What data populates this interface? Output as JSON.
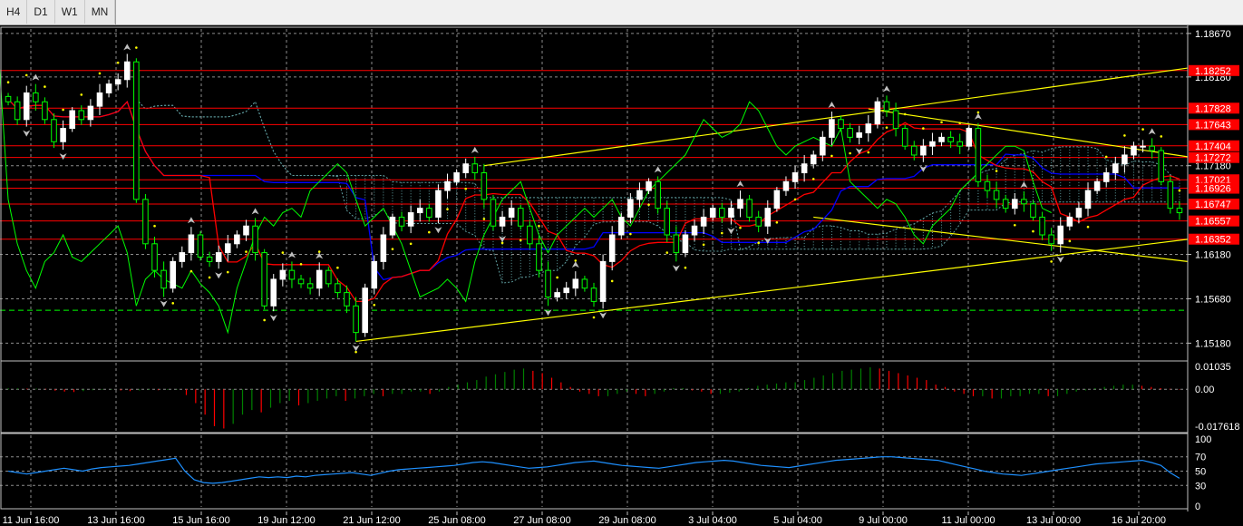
{
  "timeframes": [
    "H4",
    "D1",
    "W1",
    "MN"
  ],
  "colors": {
    "background": "#000000",
    "grid": "#8c8c8c",
    "bull_candle": "#ffffff",
    "bear_candle": "#00ff00",
    "hline": "#ff0000",
    "trendline": "#ffff00",
    "kijun": "#0000ff",
    "tenkan": "#ff0000",
    "chikou": "#00ff00",
    "cloud": "#5f9ea0",
    "sar": "#ffff00",
    "osc_up": "#008000",
    "osc_down": "#ff0000",
    "rsi": "#1e90ff"
  },
  "chart_data": [
    {
      "type": "candlestick",
      "panel": "main",
      "symbol_timeframe": "H4",
      "y_ticks": [
        "1.18670",
        "1.18180",
        "1.17180",
        "1.16180",
        "1.15680",
        "1.15180"
      ],
      "ylim": [
        1.15,
        1.1872
      ],
      "x_ticks": [
        "11 Jun 16:00",
        "13 Jun 16:00",
        "15 Jun 16:00",
        "19 Jun 12:00",
        "21 Jun 12:00",
        "25 Jun 08:00",
        "27 Jun 08:00",
        "29 Jun 08:00",
        "3 Jul 04:00",
        "5 Jul 04:00",
        "9 Jul 00:00",
        "11 Jul 00:00",
        "13 Jul 00:00",
        "16 Jul 20:00"
      ],
      "horizontal_levels": [
        {
          "label": "1.18252",
          "value": 1.18252
        },
        {
          "label": "1.17828",
          "value": 1.17828
        },
        {
          "label": "1.17643",
          "value": 1.17643
        },
        {
          "label": "1.17404",
          "value": 1.17404
        },
        {
          "label": "1.17272",
          "value": 1.17272
        },
        {
          "label": "1.17021",
          "value": 1.17021
        },
        {
          "label": "1.16926",
          "value": 1.16926
        },
        {
          "label": "1.16747",
          "value": 1.16747
        },
        {
          "label": "1.16557",
          "value": 1.16557
        },
        {
          "label": "1.16352",
          "value": 1.16352
        }
      ],
      "green_dashed_level": 1.1555,
      "series": [
        {
          "values": [
            1.179,
            1.177,
            1.18,
            1.179,
            1.177,
            1.1745,
            1.176,
            1.178,
            1.177,
            1.1785,
            1.18,
            1.181,
            1.1815,
            1.1835,
            1.168,
            1.163,
            1.16,
            1.158,
            1.161,
            1.162,
            1.164,
            1.1615,
            1.161,
            1.162,
            1.163,
            1.164,
            1.165,
            1.162,
            1.156,
            1.159,
            1.16,
            1.159,
            1.1585,
            1.158,
            1.16,
            1.1585,
            1.1575,
            1.156,
            1.153,
            1.158,
            1.161,
            1.164,
            1.166,
            1.165,
            1.1665,
            1.167,
            1.166,
            1.169,
            1.17,
            1.171,
            1.172,
            1.171,
            1.168,
            1.165,
            1.166,
            1.167,
            1.165,
            1.163,
            1.16,
            1.157,
            1.1575,
            1.158,
            1.159,
            1.158,
            1.1565,
            1.161,
            1.164,
            1.166,
            1.168,
            1.169,
            1.17,
            1.167,
            1.164,
            1.162,
            1.164,
            1.165,
            1.166,
            1.167,
            1.166,
            1.167,
            1.168,
            1.166,
            1.165,
            1.167,
            1.169,
            1.17,
            1.171,
            1.172,
            1.173,
            1.175,
            1.177,
            1.176,
            1.175,
            1.1755,
            1.1765,
            1.179,
            1.178,
            1.176,
            1.174,
            1.173,
            1.174,
            1.1745,
            1.175,
            1.1745,
            1.174,
            1.176,
            1.17,
            1.169,
            1.168,
            1.167,
            1.168,
            1.1675,
            1.166,
            1.164,
            1.163,
            1.165,
            1.166,
            1.167,
            1.169,
            1.17,
            1.171,
            1.172,
            1.173,
            1.174,
            1.174,
            1.1735,
            1.17,
            1.167,
            1.1665
          ]
        }
      ]
    },
    {
      "type": "bar",
      "panel": "oscillator",
      "y_ticks": [
        "0.01035",
        "0.00",
        "-0.017618"
      ],
      "ylim": [
        -0.018,
        0.0115
      ],
      "series": [
        {
          "values": [
            0.0004,
            0.0004,
            0.0003,
            0.0003,
            0.0002,
            -0.0006,
            -0.001,
            -0.0012,
            -0.0008,
            -0.0004,
            -0.0003,
            -0.0002,
            -0.0005,
            -0.0008,
            -0.0005,
            -0.0003,
            -0.0004,
            -0.0003,
            -0.0002,
            -0.0025,
            -0.006,
            -0.011,
            -0.016,
            -0.017,
            -0.015,
            -0.011,
            -0.009,
            -0.01,
            -0.008,
            -0.006,
            -0.005,
            -0.007,
            -0.006,
            -0.005,
            -0.004,
            -0.003,
            -0.005,
            -0.004,
            -0.003,
            -0.002,
            -0.003,
            -0.002,
            -0.002,
            -0.001,
            -0.001,
            -0.002,
            -0.001,
            0.001,
            0.002,
            0.003,
            0.004,
            0.0055,
            0.0065,
            0.0075,
            0.0085,
            0.009,
            0.008,
            0.007,
            0.005,
            0.003,
            0.001,
            -0.001,
            -0.002,
            -0.003,
            -0.003,
            -0.002,
            -0.001,
            -0.002,
            -0.003,
            -0.002,
            -0.001,
            0.0005,
            0.0005,
            -0.0005,
            -0.001,
            -0.002,
            -0.002,
            -0.0015,
            -0.001,
            0.0005,
            0.0015,
            0.002,
            0.0025,
            0.003,
            0.003,
            0.004,
            0.005,
            0.006,
            0.007,
            0.008,
            0.0085,
            0.009,
            0.0095,
            0.009,
            0.008,
            0.007,
            0.006,
            0.005,
            0.004,
            0.002,
            0.001,
            -0.001,
            -0.002,
            -0.003,
            -0.003,
            -0.004,
            -0.004,
            -0.003,
            -0.003,
            -0.002,
            -0.002,
            -0.003,
            -0.003,
            -0.002,
            -0.001,
            -0.0005,
            0.0005,
            0.001,
            0.0015,
            0.002,
            0.002,
            0.0015,
            0.001,
            0.0005,
            0.0002,
            -0.0002
          ]
        }
      ]
    },
    {
      "type": "line",
      "panel": "rsi",
      "y_ticks": [
        "100",
        "70",
        "50",
        "30",
        "0"
      ],
      "ylim": [
        0,
        100
      ],
      "series": [
        {
          "values": [
            50,
            48,
            46,
            48,
            50,
            52,
            54,
            52,
            50,
            53,
            55,
            56,
            57,
            58,
            60,
            62,
            64,
            66,
            68,
            50,
            38,
            34,
            33,
            34,
            36,
            38,
            40,
            42,
            41,
            42,
            41,
            43,
            42,
            44,
            45,
            46,
            47,
            48,
            46,
            44,
            47,
            50,
            52,
            53,
            54,
            55,
            56,
            57,
            58,
            60,
            62,
            63,
            62,
            60,
            58,
            56,
            54,
            55,
            56,
            58,
            60,
            62,
            63,
            64,
            62,
            60,
            58,
            57,
            56,
            55,
            54,
            56,
            58,
            60,
            62,
            63,
            64,
            65,
            64,
            62,
            60,
            58,
            57,
            56,
            55,
            57,
            59,
            61,
            63,
            65,
            66,
            67,
            68,
            69,
            70,
            70,
            69,
            68,
            67,
            66,
            65,
            62,
            59,
            56,
            53,
            50,
            48,
            46,
            45,
            44,
            46,
            48,
            50,
            52,
            54,
            56,
            58,
            60,
            61,
            62,
            63,
            64,
            65,
            62,
            58,
            48,
            40
          ]
        }
      ]
    }
  ]
}
